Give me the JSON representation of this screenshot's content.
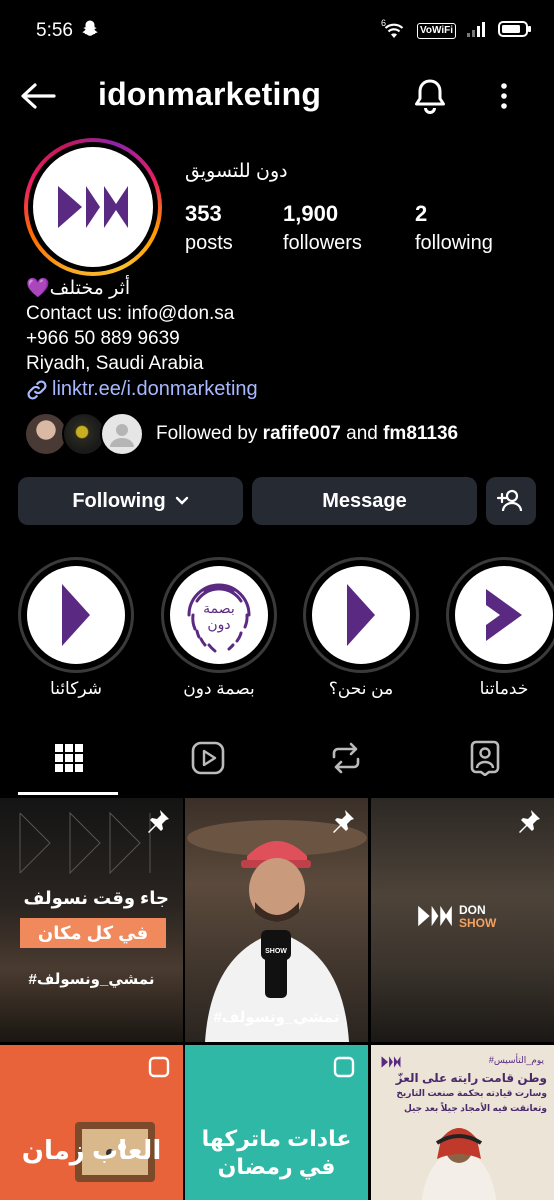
{
  "status_bar": {
    "time": "5:56",
    "vowifi": "VoWiFi",
    "wifi_sup": "6"
  },
  "header": {
    "username": "idonmarketing"
  },
  "profile": {
    "full_name": "دون للتسويق",
    "stats": [
      {
        "num": "353",
        "label": "posts"
      },
      {
        "num": "1,900",
        "label": "followers"
      },
      {
        "num": "2",
        "label": "following"
      }
    ],
    "bio_lines": [
      "💜أثر مختلف",
      "Contact us: info@don.sa",
      "+966 50 889 9639",
      "Riyadh, Saudi Arabia"
    ],
    "link": "linktr.ee/i.donmarketing",
    "followed_by_prefix": "Followed by ",
    "followed_by_user1": "rafife007",
    "followed_by_and": " and ",
    "followed_by_user2": "fm81136"
  },
  "buttons": {
    "following": "Following",
    "message": "Message"
  },
  "highlights": [
    {
      "label": "خدماتنا"
    },
    {
      "label": "من نحن؟"
    },
    {
      "label": "بصمة دون"
    },
    {
      "label": "شركائنا"
    }
  ],
  "highlight_texts": {
    "basma_line1": "بصمة",
    "basma_line2": "دون"
  },
  "posts": {
    "p1_line1": "جاء وقت نسولف",
    "p1_line2": "في كل مكان",
    "p1_tag": "#نمشي_ونسولف",
    "p2_tag": "#نمشي_ونسولف",
    "p2_mic": "SHOW",
    "p3_brand1": "DON",
    "p3_brand2": "SHOW",
    "p4_text": "العاب زمان",
    "p5_text1": "عادات ماتركها",
    "p5_text2": "في رمضان",
    "p6_tag": "#يوم_التأسيس",
    "p6_line1": "وطن قامت رايته على العزّ",
    "p6_line2": "وسارت قيادته بحكمة صنعت التاريخ",
    "p6_line3": "وتعانقت فيه الأمجاد جيلاً بعد جيل"
  },
  "colors": {
    "brand_purple": "#5a2a82",
    "link_blue": "#a7b8ff",
    "button_bg": "#262a33"
  }
}
